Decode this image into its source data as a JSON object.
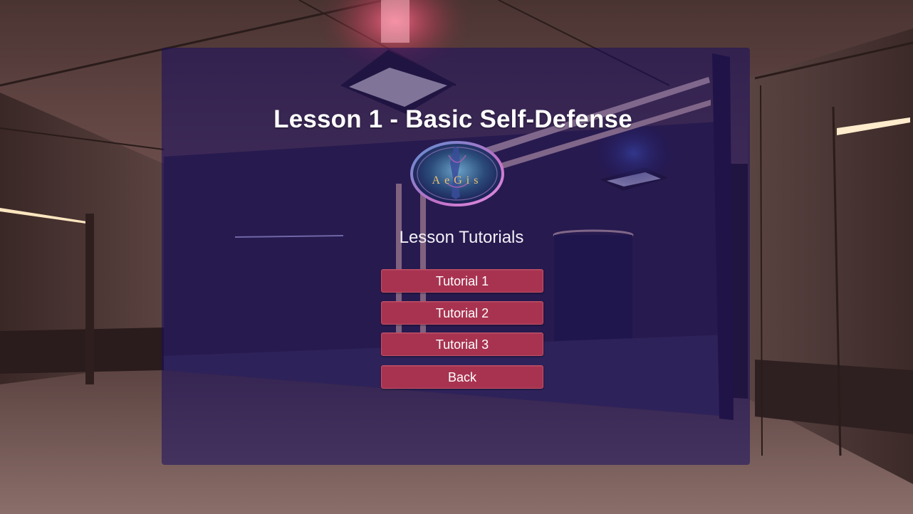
{
  "menu": {
    "title": "Lesson 1 - Basic Self-Defense",
    "logo_text": "AeGis",
    "subtitle": "Lesson Tutorials",
    "buttons": {
      "tutorial_1": "Tutorial 1",
      "tutorial_2": "Tutorial 2",
      "tutorial_3": "Tutorial 3",
      "back": "Back"
    }
  },
  "colors": {
    "panel_overlay": "#180c60",
    "button": "#a83350",
    "title_text": "#ffffff"
  },
  "icons": {
    "logo": "aegis-emblem-icon"
  }
}
